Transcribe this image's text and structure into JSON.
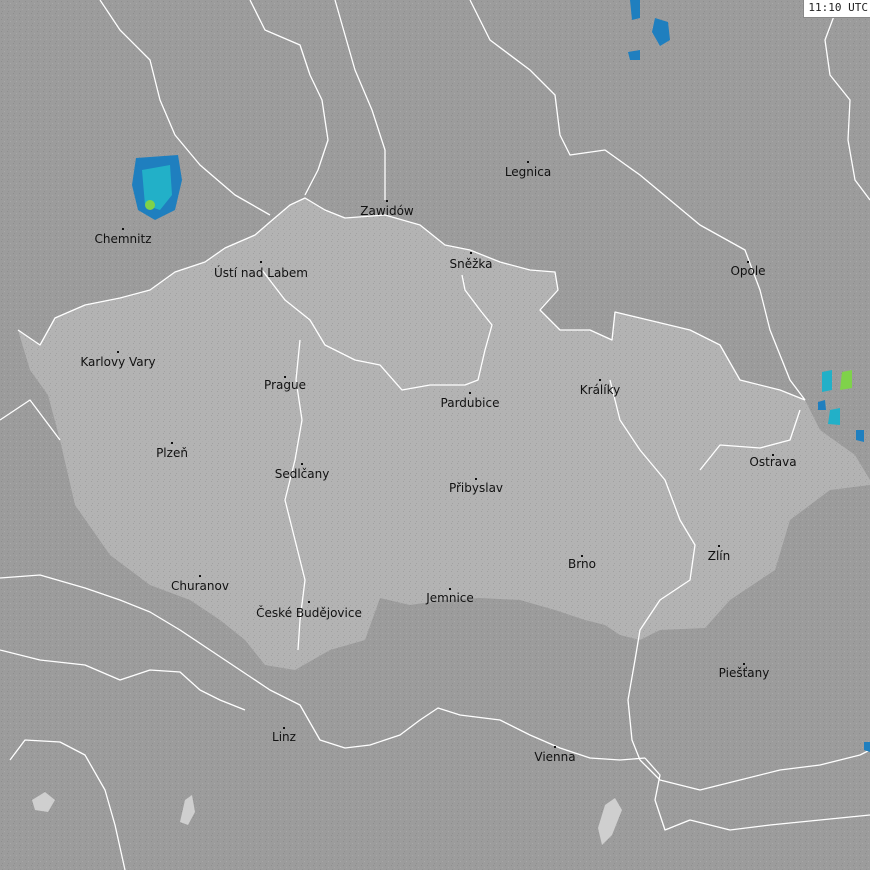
{
  "timestamp": "11:10 UTC",
  "colors": {
    "background": "#9c9c9c",
    "focus_region": "#b3b3b3",
    "border_line": "#ffffff",
    "lake": "#cfcfcf",
    "radar_low": "#1f7fbf",
    "radar_mid": "#22b0c8",
    "radar_high": "#7fd24a"
  },
  "places": [
    {
      "key": "chemnitz",
      "name": "Chemnitz"
    },
    {
      "key": "zawidow",
      "name": "Zawidów"
    },
    {
      "key": "legnica",
      "name": "Legnica"
    },
    {
      "key": "usti",
      "name": "Ústí nad Labem"
    },
    {
      "key": "snezka",
      "name": "Sněžka"
    },
    {
      "key": "opole",
      "name": "Opole"
    },
    {
      "key": "karlovy-vary",
      "name": "Karlovy Vary"
    },
    {
      "key": "prague",
      "name": "Prague"
    },
    {
      "key": "pardubice",
      "name": "Pardubice"
    },
    {
      "key": "kraliky",
      "name": "Králíky"
    },
    {
      "key": "plzen",
      "name": "Plzeň"
    },
    {
      "key": "ostrava",
      "name": "Ostrava"
    },
    {
      "key": "sedlcany",
      "name": "Sedlčany"
    },
    {
      "key": "pribyslav",
      "name": "Přibyslav"
    },
    {
      "key": "zlin",
      "name": "Zlín"
    },
    {
      "key": "brno",
      "name": "Brno"
    },
    {
      "key": "churanov",
      "name": "Churanov"
    },
    {
      "key": "jemnice",
      "name": "Jemnice"
    },
    {
      "key": "budejovice",
      "name": "České Budějovice"
    },
    {
      "key": "piestany",
      "name": "Piešťany"
    },
    {
      "key": "linz",
      "name": "Linz"
    },
    {
      "key": "vienna",
      "name": "Vienna"
    }
  ]
}
